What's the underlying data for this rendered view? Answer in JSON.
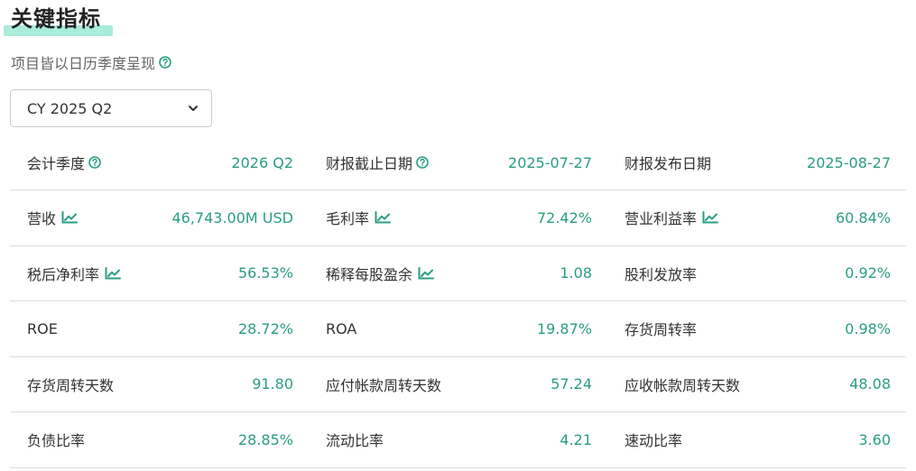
{
  "header": {
    "title": "关键指标",
    "subtitle": "项目皆以日历季度呈现"
  },
  "period_select": {
    "value": "CY 2025 Q2"
  },
  "colors": {
    "accent": "#2a9d84",
    "highlight": "#a8ecd9",
    "text": "#333333",
    "divider": "#dcdcdc"
  },
  "rows": [
    [
      {
        "label": "会计季度",
        "value": "2026 Q2",
        "icon": "help-icon"
      },
      {
        "label": "财报截止日期",
        "value": "2025-07-27",
        "icon": "help-icon"
      },
      {
        "label": "财报发布日期",
        "value": "2025-08-27",
        "icon": ""
      }
    ],
    [
      {
        "label": "营收",
        "value": "46,743.00M USD",
        "icon": "chart-icon"
      },
      {
        "label": "毛利率",
        "value": "72.42%",
        "icon": "chart-icon"
      },
      {
        "label": "营业利益率",
        "value": "60.84%",
        "icon": "chart-icon"
      }
    ],
    [
      {
        "label": "税后净利率",
        "value": "56.53%",
        "icon": "chart-icon"
      },
      {
        "label": "稀释每股盈余",
        "value": "1.08",
        "icon": "chart-icon"
      },
      {
        "label": "股利发放率",
        "value": "0.92%",
        "icon": ""
      }
    ],
    [
      {
        "label": "ROE",
        "value": "28.72%",
        "icon": ""
      },
      {
        "label": "ROA",
        "value": "19.87%",
        "icon": ""
      },
      {
        "label": "存货周转率",
        "value": "0.98%",
        "icon": ""
      }
    ],
    [
      {
        "label": "存货周转天数",
        "value": "91.80",
        "icon": ""
      },
      {
        "label": "应付帐款周转天数",
        "value": "57.24",
        "icon": ""
      },
      {
        "label": "应收帐款周转天数",
        "value": "48.08",
        "icon": ""
      }
    ],
    [
      {
        "label": "负债比率",
        "value": "28.85%",
        "icon": ""
      },
      {
        "label": "流动比率",
        "value": "4.21",
        "icon": ""
      },
      {
        "label": "速动比率",
        "value": "3.60",
        "icon": ""
      }
    ]
  ]
}
